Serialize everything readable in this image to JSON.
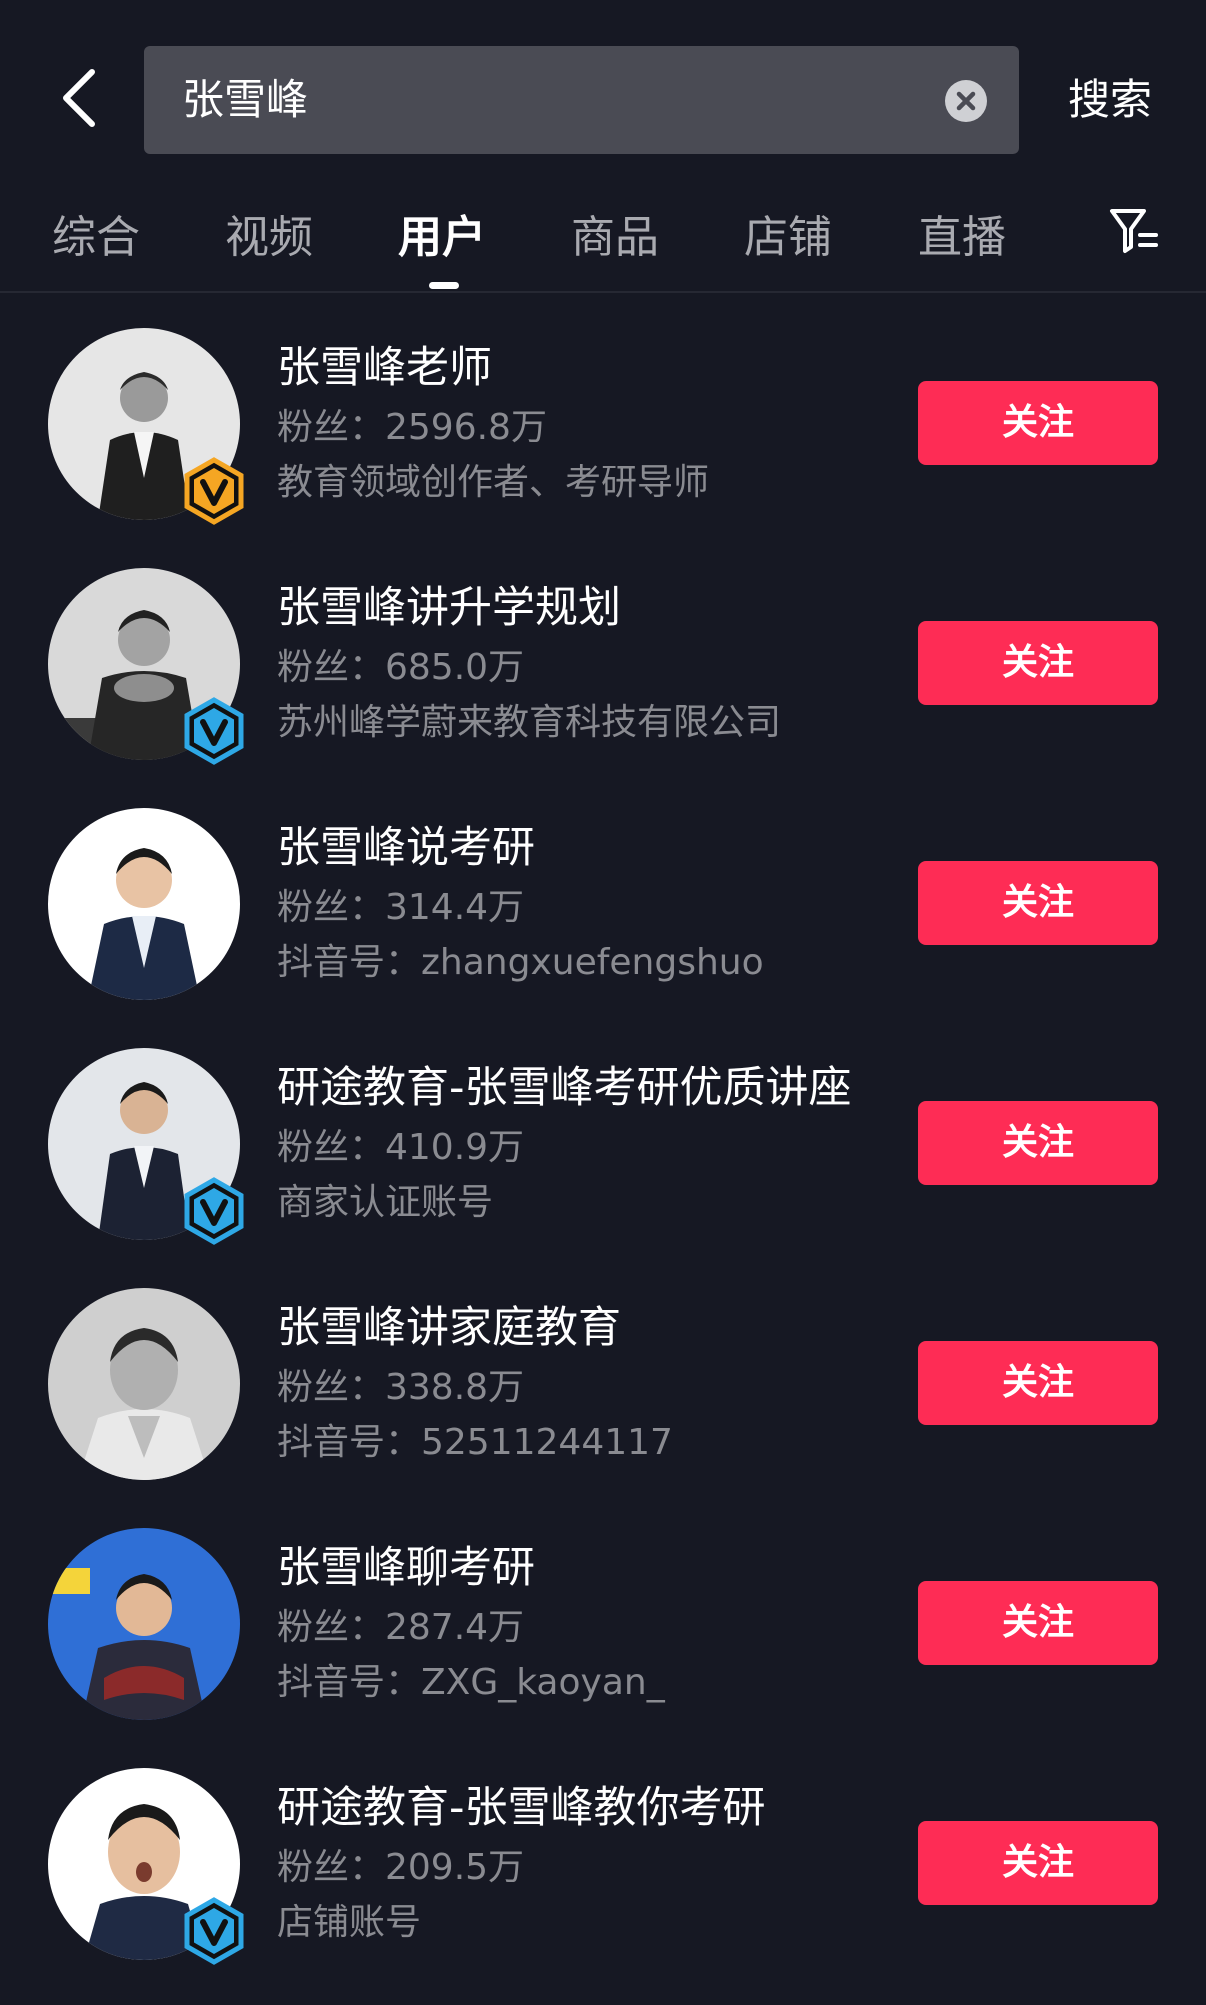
{
  "search": {
    "query": "张雪峰",
    "button_label": "搜索"
  },
  "tabs": [
    {
      "label": "综合"
    },
    {
      "label": "视频"
    },
    {
      "label": "用户"
    },
    {
      "label": "商品"
    },
    {
      "label": "店铺"
    },
    {
      "label": "直播"
    }
  ],
  "active_tab": "用户",
  "icons": {
    "back": "back-arrow-icon",
    "clear": "clear-icon",
    "filter": "filter-icon",
    "verified": "verified-v-icon"
  },
  "colors": {
    "background": "#161823",
    "follow_button": "#fe2c55",
    "badge_gold": "#f5a623",
    "badge_blue": "#2ea8e6",
    "secondary_text": "#8a8b91"
  },
  "users": [
    {
      "name": "张雪峰老师",
      "fans": "粉丝：2596.8万",
      "desc": "教育领域创作者、考研导师",
      "follow_label": "关注",
      "badge": "gold"
    },
    {
      "name": "张雪峰讲升学规划",
      "fans": "粉丝：685.0万",
      "desc": "苏州峰学蔚来教育科技有限公司",
      "follow_label": "关注",
      "badge": "blue"
    },
    {
      "name": "张雪峰说考研",
      "fans": "粉丝：314.4万",
      "desc": "抖音号：zhangxuefengshuo",
      "follow_label": "关注",
      "badge": "none"
    },
    {
      "name": "研途教育-张雪峰考研优质讲座",
      "fans": "粉丝：410.9万",
      "desc": "商家认证账号",
      "follow_label": "关注",
      "badge": "blue"
    },
    {
      "name": "张雪峰讲家庭教育",
      "fans": "粉丝：338.8万",
      "desc": "抖音号：52511244117",
      "follow_label": "关注",
      "badge": "none"
    },
    {
      "name": "张雪峰聊考研",
      "fans": "粉丝：287.4万",
      "desc": "抖音号：ZXG_kaoyan_",
      "follow_label": "关注",
      "badge": "none"
    },
    {
      "name": "研途教育-张雪峰教你考研",
      "fans": "粉丝：209.5万",
      "desc": "店铺账号",
      "follow_label": "关注",
      "badge": "blue"
    }
  ]
}
